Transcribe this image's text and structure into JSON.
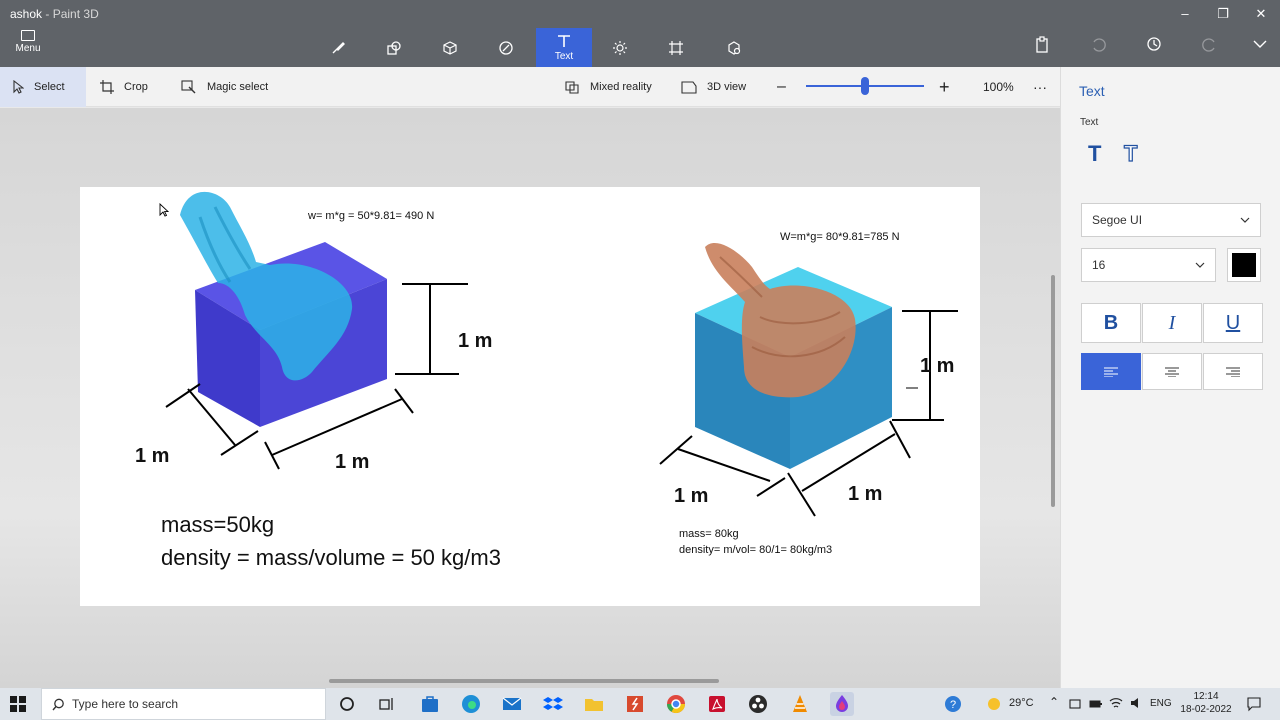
{
  "window": {
    "title": "ashok",
    "app_name": "Paint 3D"
  },
  "menu": {
    "label": "Menu"
  },
  "toolbar": {
    "active_tool_label": "Text"
  },
  "command_bar": {
    "select_label": "Select",
    "crop_label": "Crop",
    "magic_select_label": "Magic select",
    "mixed_reality_label": "Mixed reality",
    "view_3d_label": "3D view",
    "zoom_percent": "100%",
    "zoom_slider_value_percent": 50
  },
  "canvas": {
    "weight_left": "w= m*g = 50*9.81=  490 N",
    "weight_right": "W=m*g= 80*9.81=785 N",
    "dim_left_height": "1 m",
    "dim_left_depth": "1 m",
    "dim_left_width": "1 m",
    "dim_right_height": "1 m",
    "dim_right_depth": "1 m",
    "dim_right_width": "1 m",
    "mass_left": "mass=50kg",
    "density_left": "density = mass/volume = 50 kg/m3",
    "mass_right": "mass= 80kg",
    "density_right": "density= m/vol= 80/1= 80kg/m3",
    "colors": {
      "cube_left_front": "#4b45d6",
      "cube_left_top": "#5a54e6",
      "cube_right_front": "#2f8fc4",
      "cube_right_top": "#4fd1ee",
      "sketch_left": "#2db3e6",
      "sketch_right": "#c97f5c"
    }
  },
  "panel": {
    "title": "Text",
    "section_label": "Text",
    "font_family": "Segoe UI",
    "font_size": "16",
    "text_color": "#000000",
    "bold": "B",
    "italic": "I",
    "underline": "U"
  },
  "taskbar": {
    "search_placeholder": "Type here to search",
    "temperature": "29°C",
    "language": "ENG",
    "time": "12:14",
    "date": "18-02-2022"
  }
}
